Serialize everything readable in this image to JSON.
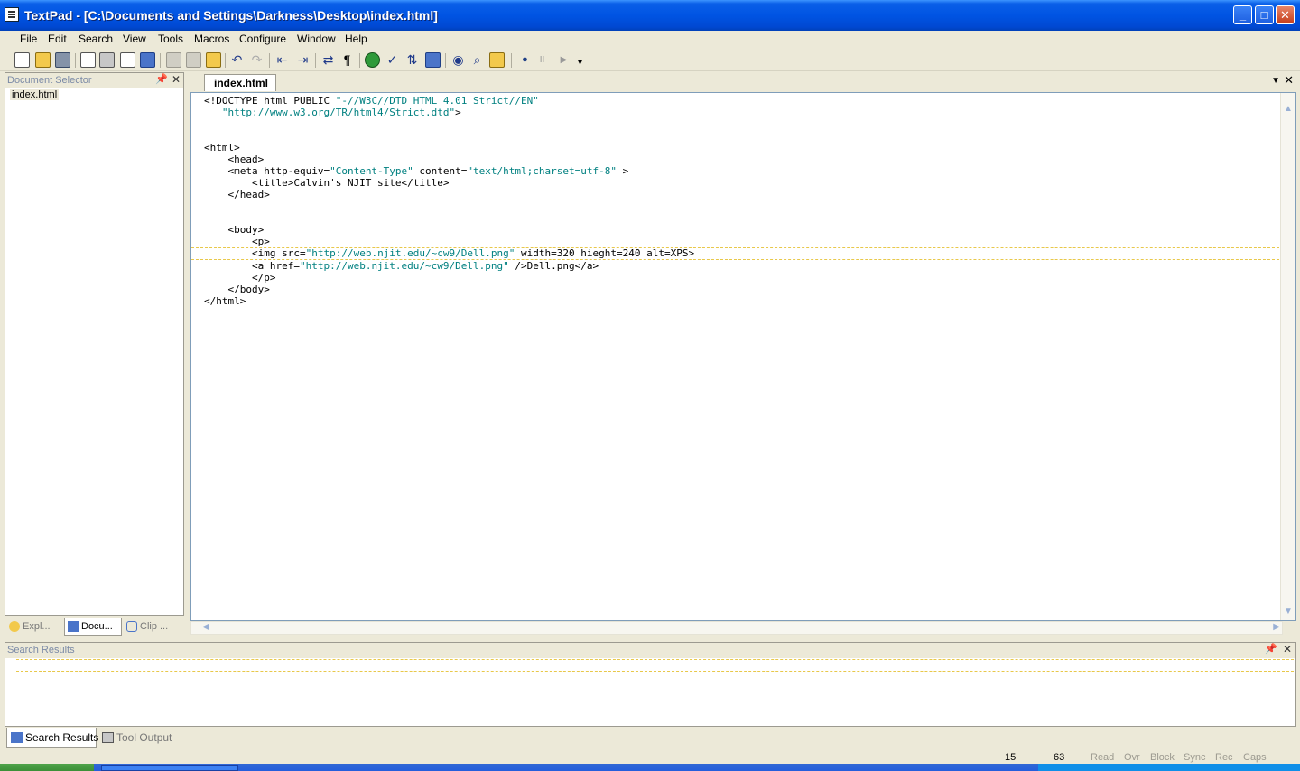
{
  "window": {
    "title": "TextPad - [C:\\Documents and Settings\\Darkness\\Desktop\\index.html]",
    "minimize_label": "_",
    "maximize_label": "□",
    "close_label": "✕"
  },
  "menu": [
    "File",
    "Edit",
    "Search",
    "View",
    "Tools",
    "Macros",
    "Configure",
    "Window",
    "Help"
  ],
  "toolbar": {
    "icons": [
      "new-file",
      "open-folder",
      "save",
      "save-all",
      "print",
      "print-preview",
      "properties",
      "cut",
      "copy",
      "paste",
      "undo",
      "redo",
      "decrease-indent",
      "increase-indent",
      "word-wrap",
      "show-paragraph",
      "browser",
      "spell-check",
      "sort",
      "find-in-files",
      "view",
      "find",
      "replace",
      "record-macro",
      "pause-macro",
      "play-macro",
      "toolbar-options"
    ],
    "paragraph_glyph": "¶",
    "record_glyph": "●",
    "pause_glyph": "II",
    "play_glyph": "▶",
    "options_glyph": "▾"
  },
  "document_selector": {
    "title": "Document Selector",
    "pin_glyph": "📌",
    "close_glyph": "✕",
    "documents": [
      "index.html"
    ],
    "tabs": [
      "Expl...",
      "Docu...",
      "Clip ..."
    ]
  },
  "editor": {
    "tab_label": "index.html",
    "dropdown_glyph": "▼",
    "close_glyph": "✕",
    "current_line_index": 13,
    "lines": [
      "<!DOCTYPE html PUBLIC \"-//W3C//DTD HTML 4.01 Strict//EN\"",
      "   \"http://www.w3.org/TR/html4/Strict.dtd\">",
      "",
      "",
      "<html>",
      "    <head>",
      "    <meta http-equiv=\"Content-Type\" content=\"text/html;charset=utf-8\" >",
      "        <title>Calvin's NJIT site</title>",
      "    </head>",
      "",
      "",
      "    <body>",
      "        <p>",
      "        <img src=\"http://web.njit.edu/~cw9/Dell.png\" width=320 hieght=240 alt=XPS>",
      "        <a href=\"http://web.njit.edu/~cw9/Dell.png\" />Dell.png</a>",
      "        </p>",
      "    </body>",
      "</html>"
    ]
  },
  "search_results": {
    "title": "Search Results",
    "pin_glyph": "📌",
    "close_glyph": "✕",
    "tabs": [
      "Search Results",
      "Tool Output"
    ]
  },
  "status": {
    "line": "15",
    "column": "63",
    "indicators": [
      "Read",
      "Ovr",
      "Block",
      "Sync",
      "Rec",
      "Caps"
    ]
  },
  "colors": {
    "title_bar": "#0054e3",
    "tag": "#000080",
    "string": "#008080",
    "current_line_marker": "#e8c84a"
  }
}
